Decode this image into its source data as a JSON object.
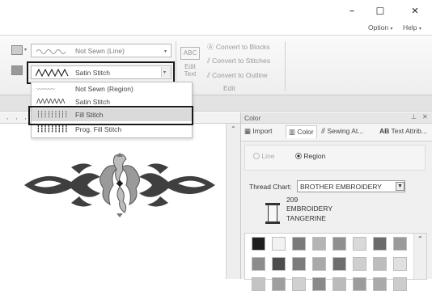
{
  "window": {
    "minimize_glyph": "–",
    "maximize_glyph": "☐",
    "close_glyph": "✕"
  },
  "menu": {
    "option_label": "Option",
    "help_label": "Help",
    "arrow": "▾",
    "extra_arrow": "▾"
  },
  "ribbon": {
    "line_sew_dropdown_value": "Not Sewn (Line)",
    "region_sew_dropdown_value": "Satin Stitch",
    "edit_text_icon_label": "ABC",
    "edit_text_label_line1": "Edit",
    "edit_text_label_line2": "Text",
    "convert_blocks_label": "Convert to Blocks",
    "convert_stitches_label": "Convert to Stitches",
    "convert_outline_label": "Convert to Outline",
    "edit_group_label": "Edit"
  },
  "dropdown_list": {
    "items": [
      {
        "label": "Not Sewn (Region)",
        "glyph": "〰〰〰"
      },
      {
        "label": "Satin Stitch",
        "glyph": "ΛΛΛΛΛΛΛ"
      },
      {
        "label": "Fill Stitch",
        "glyph": "┆┆┆┆┆┆┆┆┆"
      },
      {
        "label": "Prog. Fill Stitch",
        "glyph": "┇┇┇┇┇┇┇┇┇"
      }
    ],
    "selected_index": 2
  },
  "ruler": {
    "marks": ",    ,    ,    ,    ,    ,    ,    ,    ,    ,"
  },
  "color_panel": {
    "title": "Color",
    "pin_glyph": "⊥",
    "close_glyph": "✕",
    "tabs": [
      {
        "label": "Import"
      },
      {
        "label": "Color"
      },
      {
        "label": "Sewing At..."
      },
      {
        "label": "Text Attrib..."
      }
    ],
    "line_radio_label": "Line",
    "region_radio_label": "Region",
    "thread_chart_label": "Thread Chart:",
    "thread_chart_value": "BROTHER EMBROIDERY",
    "thread_code": "209",
    "thread_brand": "EMBROIDERY",
    "thread_name": "TANGERINE",
    "swatch_colors_row1": [
      "#1e1e1e",
      "#f2f2f2",
      "#7a7a7a",
      "#b5b5b5",
      "#8f8f8f",
      "#d9d9d9",
      "#6b6b6b",
      "#9a9a9a"
    ],
    "swatch_colors_row2": [
      "#8c8c8c",
      "#4d4d4d",
      "#7c7c7c",
      "#a9a9a9",
      "#6e6e6e",
      "#cfcfcf",
      "#bdbdbd",
      "#e0e0e0"
    ],
    "swatch_colors_row3": [
      "#c4c4c4",
      "#9e9e9e",
      "#d0d0d0",
      "#8a8a8a",
      "#bbbbbb",
      "#9c9c9c",
      "#aaaaaa",
      "#cccccc"
    ]
  },
  "colors": {
    "highlight_border": "#1a1a1a",
    "selected_item_bg": "#dadada"
  }
}
